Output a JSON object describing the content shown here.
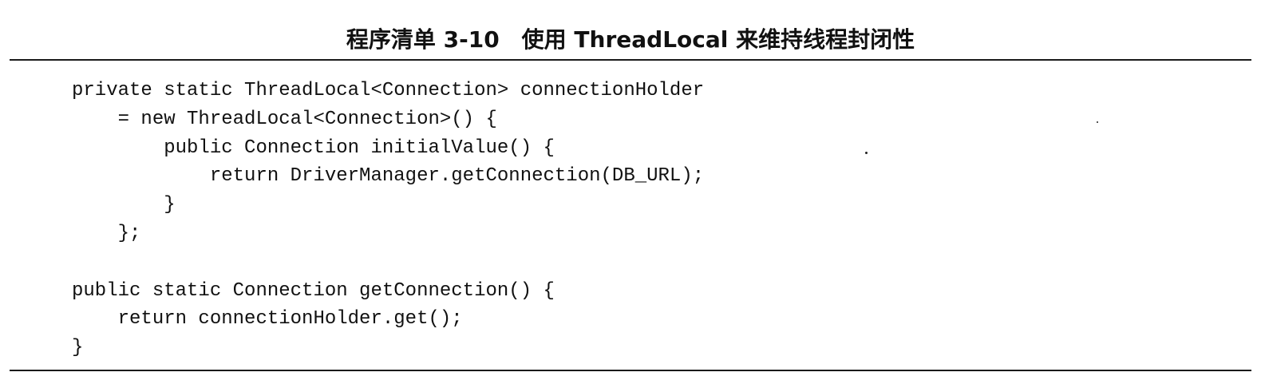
{
  "listing": {
    "title": "程序清单 3-10　使用 ThreadLocal 来维持线程封闭性",
    "code_lines": [
      "private static ThreadLocal<Connection> connectionHolder",
      "    = new ThreadLocal<Connection>() {",
      "        public Connection initialValue() {",
      "            return DriverManager.getConnection(DB_URL);",
      "        }",
      "    };",
      "",
      "public static Connection getConnection() {",
      "    return connectionHolder.get();",
      "}"
    ]
  }
}
